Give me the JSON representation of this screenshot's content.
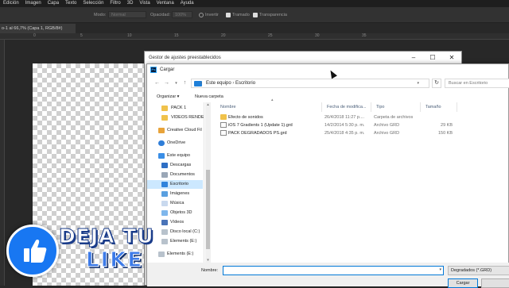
{
  "ps": {
    "menu": [
      "Edición",
      "Imagen",
      "Capa",
      "Texto",
      "Selección",
      "Filtro",
      "3D",
      "Vista",
      "Ventana",
      "Ayuda"
    ],
    "options": {
      "modo_label": "Modo:",
      "modo_value": "Normal",
      "opacidad_label": "Opacidad:",
      "opacidad_value": "100%",
      "invertir": "Invertir",
      "tramado": "Tramado",
      "transparencia": "Transparencia"
    },
    "doc_tab": "o-1 al 66,7% (Capa 1, RGB/8#)",
    "ruler": [
      "0",
      "5",
      "10",
      "15",
      "20",
      "25",
      "30",
      "35"
    ]
  },
  "preset_window": {
    "title": "Gestor de ajustes preestablecidos"
  },
  "dialog": {
    "title": "Cargar",
    "ps_icon": "Ps",
    "breadcrumb": [
      "Este equipo",
      "Escritorio"
    ],
    "search_placeholder": "Buscar en Escritorio",
    "organize": "Organizar ▾",
    "new_folder": "Nueva carpeta",
    "sidebar": [
      {
        "label": "PACK 1",
        "icon": "folder-icon"
      },
      {
        "label": "VIDEOS RENDER",
        "icon": "folder-icon"
      },
      {
        "label": "Creative Cloud Fil",
        "icon": "creative-cloud-icon"
      },
      {
        "label": "OneDrive",
        "icon": "onedrive-icon"
      },
      {
        "label": "Este equipo",
        "icon": "computer-icon"
      },
      {
        "label": "Descargas",
        "icon": "download-icon"
      },
      {
        "label": "Documentos",
        "icon": "documents-icon"
      },
      {
        "label": "Escritorio",
        "icon": "desktop-icon"
      },
      {
        "label": "Imágenes",
        "icon": "pictures-icon"
      },
      {
        "label": "Música",
        "icon": "music-icon"
      },
      {
        "label": "Objetos 3D",
        "icon": "objects3d-icon"
      },
      {
        "label": "Vídeos",
        "icon": "videos-icon"
      },
      {
        "label": "Disco local (C:)",
        "icon": "drive-icon"
      },
      {
        "label": "Elements (E:)",
        "icon": "drive-icon"
      },
      {
        "label": "Elements (E:)",
        "icon": "drive-icon"
      }
    ],
    "columns": {
      "name": "Nombre",
      "date": "Fecha de modifica...",
      "type": "Tipo",
      "size": "Tamaño"
    },
    "files": [
      {
        "name": "Efecto de sonidos",
        "date": "26/4/2018 11:27 p....",
        "type": "Carpeta de archivos",
        "size": "",
        "kind": "folder"
      },
      {
        "name": "iOS 7 Gradients 1 (Update 1).grd",
        "date": "14/2/2014 5:30 p. m.",
        "type": "Archivo GRD",
        "size": "29 KB",
        "kind": "file"
      },
      {
        "name": "PACK DEGRADADOS PS.grd",
        "date": "25/4/2018 4:35 p. m.",
        "type": "Archivo GRD",
        "size": "150 KB",
        "kind": "file"
      }
    ],
    "filename_label": "Nombre:",
    "filename_value": "",
    "filetype": "Degradados (*.GRD)",
    "load_button": "Cargar",
    "cancel_button": ""
  },
  "overlay": {
    "line1": "DEJA TU",
    "line2": "LIKE"
  },
  "colors": {
    "accent": "#0078d7",
    "selected": "#cce8ff",
    "like_blue": "#1877f2"
  }
}
